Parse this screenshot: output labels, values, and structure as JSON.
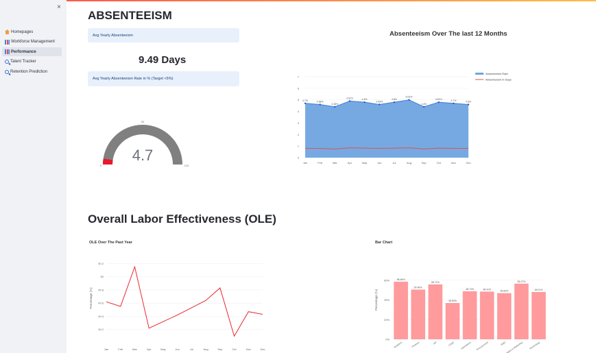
{
  "sidebar": {
    "close_label": "×",
    "items": [
      {
        "label": "Homepages",
        "icon": "home-icon"
      },
      {
        "label": "Workforce Management",
        "icon": "bar-chart-icon"
      },
      {
        "label": "Performance",
        "icon": "bar-chart-icon",
        "active": true
      },
      {
        "label": "Talent Tracker",
        "icon": "search-icon"
      },
      {
        "label": "Retention Prediction",
        "icon": "search-icon"
      }
    ]
  },
  "absenteeism": {
    "title": "ABSENTEEISM",
    "box1": "Avg Yearly Absenteeism",
    "metric": "9.49 Days",
    "box2": "Avg Yearly Absenteeism Rate in % (Target <5%)",
    "gauge": {
      "value": "4.7",
      "value_num": 4.7,
      "min": 0,
      "max": 100,
      "mid_label": "50",
      "min_label": "0",
      "max_label": "100"
    }
  },
  "chart_data": [
    {
      "type": "area",
      "title": "Absenteeism Over The last 12 Months",
      "categories": [
        "Jan",
        "Feb",
        "Mar",
        "Apr",
        "May",
        "Jun",
        "Jul",
        "Aug",
        "Sep",
        "Oct",
        "Nov",
        "Dec"
      ],
      "ylim": [
        0,
        7
      ],
      "yticks": [
        "0",
        "1",
        "2",
        "3",
        "4",
        "5",
        "6",
        "7"
      ],
      "series": [
        {
          "name": "Absenteeism Rate",
          "values": [
            4.7,
            4.6,
            4.4,
            4.9,
            4.8,
            4.6,
            4.8,
            5.0,
            4.4,
            4.8,
            4.7,
            4.6
          ],
          "labels": [
            "4.7%",
            "4.58%",
            "4.38%",
            "4.91%",
            "4.8%",
            "4.59%",
            "4.8%",
            "5.02%",
            "4.4%",
            "4.81%",
            "4.7%",
            "4.6%"
          ]
        },
        {
          "name": "Absenteeism in Days",
          "values": [
            0.8,
            0.8,
            0.75,
            0.85,
            0.82,
            0.8,
            0.82,
            0.85,
            0.75,
            0.82,
            0.8,
            0.8
          ]
        }
      ],
      "legend": "top-right"
    },
    {
      "type": "line",
      "title": "OLE Over The Past Year",
      "categories": [
        "Jan",
        "Feb",
        "Mar",
        "Apr",
        "May",
        "Jun",
        "Jul",
        "Aug",
        "Sep",
        "Oct",
        "Nov",
        "Dec"
      ],
      "ylabel": "Percentage (%)",
      "ylim": [
        49,
        50.35
      ],
      "yticks": [
        "49.2",
        "49.4",
        "49.6",
        "49.8",
        "50",
        "50.2"
      ],
      "values": [
        49.62,
        49.55,
        50.15,
        49.22,
        49.32,
        49.42,
        49.53,
        49.64,
        49.83,
        49.1,
        49.47,
        49.43
      ]
    },
    {
      "type": "bar",
      "title": "Bar Chart",
      "categories": [
        "Analytics",
        "Finance",
        "HR",
        "Legal",
        "Operations",
        "Procurement",
        "R&D",
        "Sales & Marketing",
        "Technology"
      ],
      "ylabel": "Percentage (%)",
      "ylim": [
        0,
        80
      ],
      "yticks": [
        "0%",
        "20%",
        "40%",
        "60%"
      ],
      "values": [
        58.46,
        50.46,
        55.71,
        36.84,
        48.74,
        48.41,
        46.83,
        56.47,
        48.01
      ],
      "labels": [
        "58.46%",
        "50.46%",
        "55.71%",
        "36.84%",
        "48.74%",
        "48.41%",
        "46.83%",
        "56.47%",
        "48.01%"
      ]
    }
  ],
  "ole": {
    "title": "Overall Labor Effectiveness (OLE)"
  },
  "colors": {
    "area": "#6fa4e0",
    "area_line": "#3a7bd5",
    "days_line": "#e05050",
    "ole_line": "#e8262e",
    "bar": "#ff9a9d",
    "gauge": "#808080"
  }
}
